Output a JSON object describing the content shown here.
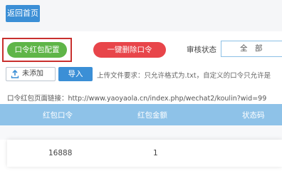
{
  "top": {
    "back_label": "返回首页"
  },
  "toolbar": {
    "config_label": "口令红包配置",
    "delete_all_label": "一键删除口令",
    "status_label": "审核状态",
    "status_value": "全　部"
  },
  "upload": {
    "file_label": "未添加",
    "import_label": "导入",
    "hint": "上传文件要求：只允许格式为.txt，自定义的口令只允许是"
  },
  "link": {
    "text": "口令红包页面链接：http://www.yaoyaola.cn/index.php/wechat2/koulin?wid=99"
  },
  "table": {
    "headers": [
      "红包口令",
      "红包金额",
      "状态码"
    ],
    "rows": [
      {
        "code": "16888",
        "amount": "1"
      }
    ]
  },
  "colors": {
    "primary": "#3b8fd6",
    "green": "#5fb548",
    "red": "#e8454a",
    "highlight": "#c8302e",
    "header": "#8ec2e8"
  }
}
